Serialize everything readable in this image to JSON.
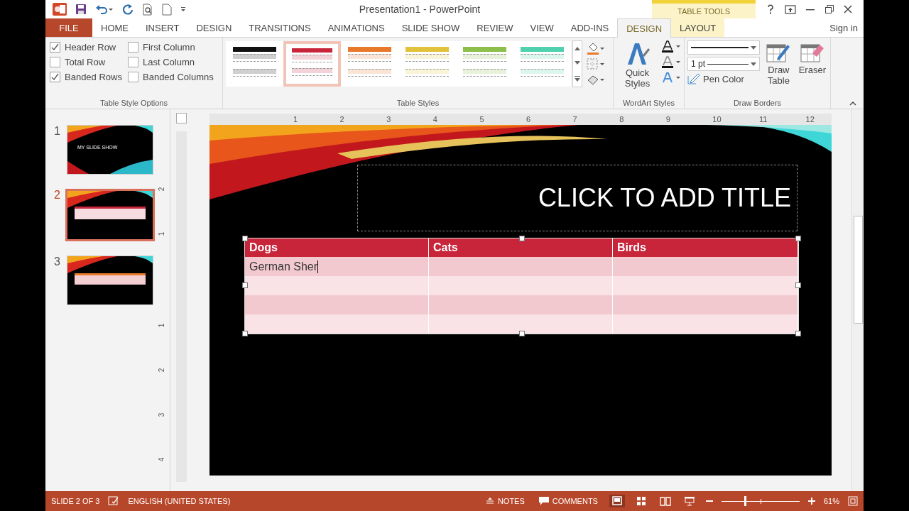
{
  "window": {
    "title": "Presentation1 - PowerPoint"
  },
  "contextual_header": "TABLE TOOLS",
  "tabs": [
    {
      "label": "FILE",
      "kind": "file",
      "selected": false
    },
    {
      "label": "HOME",
      "kind": "normal",
      "selected": false
    },
    {
      "label": "INSERT",
      "kind": "normal",
      "selected": false
    },
    {
      "label": "DESIGN",
      "kind": "normal",
      "selected": false
    },
    {
      "label": "TRANSITIONS",
      "kind": "normal",
      "selected": false
    },
    {
      "label": "ANIMATIONS",
      "kind": "normal",
      "selected": false
    },
    {
      "label": "SLIDE SHOW",
      "kind": "normal",
      "selected": false
    },
    {
      "label": "REVIEW",
      "kind": "normal",
      "selected": false
    },
    {
      "label": "VIEW",
      "kind": "normal",
      "selected": false
    },
    {
      "label": "ADD-INS",
      "kind": "normal",
      "selected": false
    },
    {
      "label": "DESIGN",
      "kind": "contextual",
      "selected": true
    },
    {
      "label": "LAYOUT",
      "kind": "contextual",
      "selected": false
    }
  ],
  "sign_in": "Sign in",
  "style_options": {
    "label": "Table Style Options",
    "items": [
      {
        "label": "Header Row",
        "checked": true
      },
      {
        "label": "First Column",
        "checked": false
      },
      {
        "label": "Total Row",
        "checked": false
      },
      {
        "label": "Last Column",
        "checked": false
      },
      {
        "label": "Banded Rows",
        "checked": true
      },
      {
        "label": "Banded Columns",
        "checked": false
      }
    ]
  },
  "table_styles": {
    "label": "Table Styles",
    "items": [
      {
        "color": "#111111",
        "selected": false
      },
      {
        "color": "#c8243a",
        "selected": true
      },
      {
        "color": "#e8792b",
        "selected": false
      },
      {
        "color": "#e2c23a",
        "selected": false
      },
      {
        "color": "#8cc04b",
        "selected": false
      },
      {
        "color": "#4fd1b0",
        "selected": false
      }
    ]
  },
  "wordart": {
    "label": "WordArt Styles",
    "quick_styles": "Quick Styles"
  },
  "draw_borders": {
    "label": "Draw Borders",
    "pen_weight": "1 pt",
    "pen_color": "Pen Color",
    "draw_table": "Draw Table",
    "eraser": "Eraser"
  },
  "ruler": {
    "horizontal": [
      "1",
      "2",
      "3",
      "4",
      "5",
      "6",
      "7",
      "8",
      "9",
      "10",
      "11",
      "12"
    ],
    "vertical": [
      "2",
      "1",
      "1",
      "2",
      "3",
      "4"
    ]
  },
  "slides": [
    {
      "number": "1",
      "title": "MY SLIDE SHOW",
      "selected": false
    },
    {
      "number": "2",
      "selected": true
    },
    {
      "number": "3",
      "selected": false
    }
  ],
  "slide": {
    "title_placeholder": "CLICK TO ADD TITLE",
    "table": {
      "columns": [
        "Dogs",
        "Cats",
        "Birds"
      ],
      "rows": [
        {
          "banded": true,
          "cells": [
            "German Sher"
          ]
        },
        {
          "banded": false
        },
        {
          "banded": true
        },
        {
          "banded": false
        }
      ]
    }
  },
  "status_bar": {
    "slide": "SLIDE 2 OF 3",
    "language": "ENGLISH (UNITED STATES)",
    "notes": "NOTES",
    "comments": "COMMENTS",
    "zoom": "61%",
    "zoom_level": {
      "level": 0.3
    }
  }
}
